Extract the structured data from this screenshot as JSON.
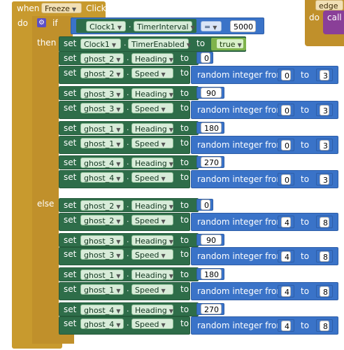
{
  "event": {
    "when": "when",
    "component": "Freeze",
    "event_name": "Click"
  },
  "controls": {
    "do": "do",
    "if": "if",
    "then": "then",
    "else": "else"
  },
  "condition": {
    "component": "Clock1",
    "property": "TimerInterval",
    "operator": "=",
    "value": "5000"
  },
  "keywords": {
    "set": "set",
    "to": "to",
    "dot": ".",
    "random": "random integer from",
    "rand_to": "to"
  },
  "then_timer": {
    "component": "Clock1",
    "property": "TimerEnabled",
    "value": "true"
  },
  "then_rows": [
    {
      "ghost": "ghost_2",
      "prop": "Heading",
      "value": "0"
    },
    {
      "ghost": "ghost_2",
      "prop": "Speed",
      "from": "0",
      "to": "3"
    },
    {
      "ghost": "ghost_3",
      "prop": "Heading",
      "value": "90"
    },
    {
      "ghost": "ghost_3",
      "prop": "Speed",
      "from": "0",
      "to": "3"
    },
    {
      "ghost": "ghost_1",
      "prop": "Heading",
      "value": "180"
    },
    {
      "ghost": "ghost_1",
      "prop": "Speed",
      "from": "0",
      "to": "3"
    },
    {
      "ghost": "ghost_4",
      "prop": "Heading",
      "value": "270"
    },
    {
      "ghost": "ghost_4",
      "prop": "Speed",
      "from": "0",
      "to": "3"
    }
  ],
  "else_rows": [
    {
      "ghost": "ghost_2",
      "prop": "Heading",
      "value": "0"
    },
    {
      "ghost": "ghost_2",
      "prop": "Speed",
      "from": "4",
      "to": "8"
    },
    {
      "ghost": "ghost_3",
      "prop": "Heading",
      "value": "90"
    },
    {
      "ghost": "ghost_3",
      "prop": "Speed",
      "from": "4",
      "to": "8"
    },
    {
      "ghost": "ghost_1",
      "prop": "Heading",
      "value": "180"
    },
    {
      "ghost": "ghost_1",
      "prop": "Speed",
      "from": "4",
      "to": "8"
    },
    {
      "ghost": "ghost_4",
      "prop": "Heading",
      "value": "270"
    },
    {
      "ghost": "ghost_4",
      "prop": "Speed",
      "from": "4",
      "to": "8"
    }
  ],
  "side_block": {
    "edge": "edge",
    "do": "do",
    "call": "call"
  },
  "colors": {
    "event": "#c89a2e",
    "set": "#2e6d49",
    "math": "#3a73c8",
    "logic": "#7fb34c",
    "procedure": "#8a3f98"
  }
}
